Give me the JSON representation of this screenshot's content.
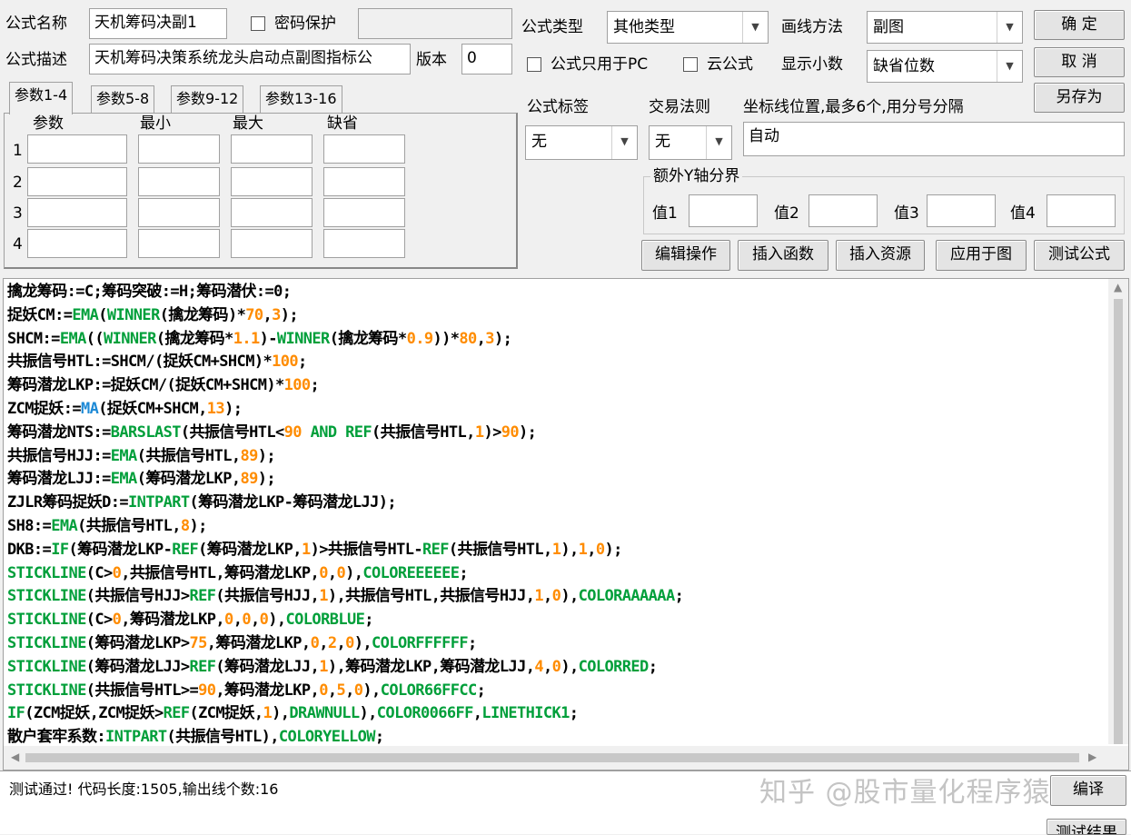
{
  "form": {
    "name_label": "公式名称",
    "name_value": "天机筹码决副1",
    "password_label": "密码保护",
    "desc_label": "公式描述",
    "desc_value": "天机筹码决策系统龙头启动点副图指标公",
    "version_label": "版本",
    "version_value": "0",
    "type_label": "公式类型",
    "type_value": "其他类型",
    "draw_label": "画线方法",
    "draw_value": "副图",
    "pc_only_label": "公式只用于PC",
    "cloud_label": "云公式",
    "decimals_label": "显示小数",
    "decimals_value": "缺省位数",
    "tag_label": "公式标签",
    "tag_value": "无",
    "rule_label": "交易法则",
    "rule_value": "无",
    "coord_label": "坐标线位置,最多6个,用分号分隔",
    "coord_value": "自动",
    "yaxis_group": "额外Y轴分界",
    "y_labels": [
      "值1",
      "值2",
      "值3",
      "值4"
    ]
  },
  "buttons": {
    "ok": "确  定",
    "cancel": "取  消",
    "save_as": "另存为",
    "edit_ops": "编辑操作",
    "insert_func": "插入函数",
    "insert_res": "插入资源",
    "apply_chart": "应用于图",
    "test": "测试公式",
    "compile": "编译",
    "test_result": "测试结果"
  },
  "params": {
    "tabs": [
      "参数1-4",
      "参数5-8",
      "参数9-12",
      "参数13-16"
    ],
    "headers": [
      "参数",
      "最小",
      "最大",
      "缺省"
    ],
    "rows": [
      "1",
      "2",
      "3",
      "4"
    ]
  },
  "code_lines": [
    [
      [
        "t",
        "擒龙筹码:=C;筹码突破:=H;筹码潜伏:=0;"
      ]
    ],
    [
      [
        "t",
        "捉妖CM:="
      ],
      [
        "f",
        "EMA"
      ],
      [
        "t",
        "("
      ],
      [
        "f",
        "WINNER"
      ],
      [
        "t",
        "(擒龙筹码)*"
      ],
      [
        "n",
        "70"
      ],
      [
        "t",
        ","
      ],
      [
        "n",
        "3"
      ],
      [
        "t",
        ");"
      ]
    ],
    [
      [
        "t",
        "SHCM:="
      ],
      [
        "f",
        "EMA"
      ],
      [
        "t",
        "(("
      ],
      [
        "f",
        "WINNER"
      ],
      [
        "t",
        "(擒龙筹码*"
      ],
      [
        "n",
        "1.1"
      ],
      [
        "t",
        ")-"
      ],
      [
        "f",
        "WINNER"
      ],
      [
        "t",
        "(擒龙筹码*"
      ],
      [
        "n",
        "0.9"
      ],
      [
        "t",
        "))*"
      ],
      [
        "n",
        "80"
      ],
      [
        "t",
        ","
      ],
      [
        "n",
        "3"
      ],
      [
        "t",
        ");"
      ]
    ],
    [
      [
        "t",
        "共振信号HTL:=SHCM/(捉妖CM+SHCM)*"
      ],
      [
        "n",
        "100"
      ],
      [
        "t",
        ";"
      ]
    ],
    [
      [
        "t",
        "筹码潜龙LKP:=捉妖CM/(捉妖CM+SHCM)*"
      ],
      [
        "n",
        "100"
      ],
      [
        "t",
        ";"
      ]
    ],
    [
      [
        "t",
        "ZCM捉妖:="
      ],
      [
        "m",
        "MA"
      ],
      [
        "t",
        "(捉妖CM+SHCM,"
      ],
      [
        "n",
        "13"
      ],
      [
        "t",
        ");"
      ]
    ],
    [
      [
        "t",
        "筹码潜龙NTS:="
      ],
      [
        "f",
        "BARSLAST"
      ],
      [
        "t",
        "(共振信号HTL<"
      ],
      [
        "n",
        "90"
      ],
      [
        "k",
        " AND "
      ],
      [
        "f",
        "REF"
      ],
      [
        "t",
        "(共振信号HTL,"
      ],
      [
        "n",
        "1"
      ],
      [
        "t",
        ")>"
      ],
      [
        "n",
        "90"
      ],
      [
        "t",
        ");"
      ]
    ],
    [
      [
        "t",
        "共振信号HJJ:="
      ],
      [
        "f",
        "EMA"
      ],
      [
        "t",
        "(共振信号HTL,"
      ],
      [
        "n",
        "89"
      ],
      [
        "t",
        ");"
      ]
    ],
    [
      [
        "t",
        "筹码潜龙LJJ:="
      ],
      [
        "f",
        "EMA"
      ],
      [
        "t",
        "(筹码潜龙LKP,"
      ],
      [
        "n",
        "89"
      ],
      [
        "t",
        ");"
      ]
    ],
    [
      [
        "t",
        "ZJLR筹码捉妖D:="
      ],
      [
        "f",
        "INTPART"
      ],
      [
        "t",
        "(筹码潜龙LKP-筹码潜龙LJJ);"
      ]
    ],
    [
      [
        "t",
        "SH8:="
      ],
      [
        "f",
        "EMA"
      ],
      [
        "t",
        "(共振信号HTL,"
      ],
      [
        "n",
        "8"
      ],
      [
        "t",
        ");"
      ]
    ],
    [
      [
        "t",
        "DKB:="
      ],
      [
        "f",
        "IF"
      ],
      [
        "t",
        "(筹码潜龙LKP-"
      ],
      [
        "f",
        "REF"
      ],
      [
        "t",
        "(筹码潜龙LKP,"
      ],
      [
        "n",
        "1"
      ],
      [
        "t",
        ")>共振信号HTL-"
      ],
      [
        "f",
        "REF"
      ],
      [
        "t",
        "(共振信号HTL,"
      ],
      [
        "n",
        "1"
      ],
      [
        "t",
        "),"
      ],
      [
        "n",
        "1"
      ],
      [
        "t",
        ","
      ],
      [
        "n",
        "0"
      ],
      [
        "t",
        ");"
      ]
    ],
    [
      [
        "f",
        "STICKLINE"
      ],
      [
        "t",
        "(C>"
      ],
      [
        "n",
        "0"
      ],
      [
        "t",
        ",共振信号HTL,筹码潜龙LKP,"
      ],
      [
        "n",
        "0"
      ],
      [
        "t",
        ","
      ],
      [
        "n",
        "0"
      ],
      [
        "t",
        "),"
      ],
      [
        "f",
        "COLOREEEEEE"
      ],
      [
        "t",
        ";"
      ]
    ],
    [
      [
        "f",
        "STICKLINE"
      ],
      [
        "t",
        "(共振信号HJJ>"
      ],
      [
        "f",
        "REF"
      ],
      [
        "t",
        "(共振信号HJJ,"
      ],
      [
        "n",
        "1"
      ],
      [
        "t",
        "),共振信号HTL,共振信号HJJ,"
      ],
      [
        "n",
        "1"
      ],
      [
        "t",
        ","
      ],
      [
        "n",
        "0"
      ],
      [
        "t",
        "),"
      ],
      [
        "f",
        "COLORAAAAAA"
      ],
      [
        "t",
        ";"
      ]
    ],
    [
      [
        "f",
        "STICKLINE"
      ],
      [
        "t",
        "(C>"
      ],
      [
        "n",
        "0"
      ],
      [
        "t",
        ",筹码潜龙LKP,"
      ],
      [
        "n",
        "0"
      ],
      [
        "t",
        ","
      ],
      [
        "n",
        "0"
      ],
      [
        "t",
        ","
      ],
      [
        "n",
        "0"
      ],
      [
        "t",
        "),"
      ],
      [
        "f",
        "COLORBLUE"
      ],
      [
        "t",
        ";"
      ]
    ],
    [
      [
        "f",
        "STICKLINE"
      ],
      [
        "t",
        "(筹码潜龙LKP>"
      ],
      [
        "n",
        "75"
      ],
      [
        "t",
        ",筹码潜龙LKP,"
      ],
      [
        "n",
        "0"
      ],
      [
        "t",
        ","
      ],
      [
        "n",
        "2"
      ],
      [
        "t",
        ","
      ],
      [
        "n",
        "0"
      ],
      [
        "t",
        "),"
      ],
      [
        "f",
        "COLORFFFFFF"
      ],
      [
        "t",
        ";"
      ]
    ],
    [
      [
        "f",
        "STICKLINE"
      ],
      [
        "t",
        "(筹码潜龙LJJ>"
      ],
      [
        "f",
        "REF"
      ],
      [
        "t",
        "(筹码潜龙LJJ,"
      ],
      [
        "n",
        "1"
      ],
      [
        "t",
        "),筹码潜龙LKP,筹码潜龙LJJ,"
      ],
      [
        "n",
        "4"
      ],
      [
        "t",
        ","
      ],
      [
        "n",
        "0"
      ],
      [
        "t",
        "),"
      ],
      [
        "f",
        "COLORRED"
      ],
      [
        "t",
        ";"
      ]
    ],
    [
      [
        "f",
        "STICKLINE"
      ],
      [
        "t",
        "(共振信号HTL>="
      ],
      [
        "n",
        "90"
      ],
      [
        "t",
        ",筹码潜龙LKP,"
      ],
      [
        "n",
        "0"
      ],
      [
        "t",
        ","
      ],
      [
        "n",
        "5"
      ],
      [
        "t",
        ","
      ],
      [
        "n",
        "0"
      ],
      [
        "t",
        "),"
      ],
      [
        "f",
        "COLOR66FFCC"
      ],
      [
        "t",
        ";"
      ]
    ],
    [
      [
        "f",
        "IF"
      ],
      [
        "t",
        "(ZCM捉妖,ZCM捉妖>"
      ],
      [
        "f",
        "REF"
      ],
      [
        "t",
        "(ZCM捉妖,"
      ],
      [
        "n",
        "1"
      ],
      [
        "t",
        "),"
      ],
      [
        "f",
        "DRAWNULL"
      ],
      [
        "t",
        "),"
      ],
      [
        "f",
        "COLOR0066FF"
      ],
      [
        "t",
        ","
      ],
      [
        "f",
        "LINETHICK1"
      ],
      [
        "t",
        ";"
      ]
    ],
    [
      [
        "t",
        "散户套牢系数:"
      ],
      [
        "f",
        "INTPART"
      ],
      [
        "t",
        "(共振信号HTL),"
      ],
      [
        "f",
        "COLORYELLOW"
      ],
      [
        "t",
        ";"
      ]
    ]
  ],
  "status": {
    "message": "测试通过! 代码长度:1505,输出线个数:16",
    "watermark": "知乎 @股市量化程序猿"
  },
  "colors": {
    "function": "#009f3a",
    "number": "#ff8c00",
    "ma": "#1e8ad6",
    "background": "#f0f0f0"
  }
}
